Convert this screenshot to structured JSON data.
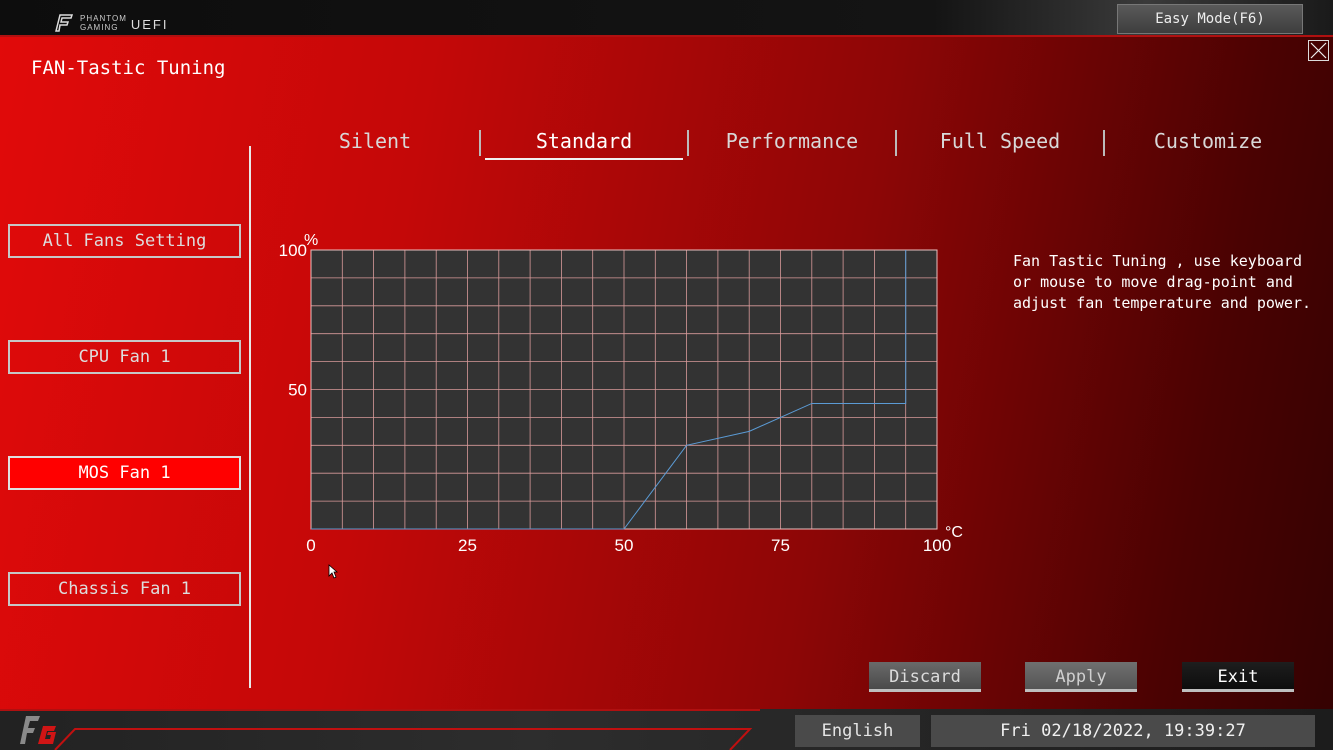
{
  "header": {
    "brand_line1": "PHANTOM",
    "brand_line2": "GAMING",
    "uefi_label": "UEFI",
    "easy_mode_label": "Easy Mode(F6)"
  },
  "page": {
    "title": "FAN-Tastic Tuning"
  },
  "sidebar": {
    "items": [
      {
        "label": "All Fans Setting",
        "active": false
      },
      {
        "label": "CPU Fan 1",
        "active": false
      },
      {
        "label": "MOS Fan 1",
        "active": true
      },
      {
        "label": "Chassis Fan 1",
        "active": false
      }
    ]
  },
  "tabs": [
    {
      "label": "Silent",
      "active": false
    },
    {
      "label": "Standard",
      "active": true
    },
    {
      "label": "Performance",
      "active": false
    },
    {
      "label": "Full Speed",
      "active": false
    },
    {
      "label": "Customize",
      "active": false
    }
  ],
  "chart_data": {
    "type": "line",
    "y_unit": "%",
    "x_unit": "°C",
    "xlim": [
      0,
      100
    ],
    "ylim": [
      0,
      100
    ],
    "x_ticks": [
      "0",
      "25",
      "50",
      "75",
      "100"
    ],
    "y_ticks": [
      "100",
      "50"
    ],
    "grid": true,
    "grid_step_x": 5,
    "grid_step_y": 10,
    "series": [
      {
        "x": [
          0,
          50,
          60,
          70,
          80,
          95,
          95
        ],
        "y": [
          0,
          0,
          30,
          35,
          45,
          45,
          100
        ]
      }
    ]
  },
  "help": {
    "text": "Fan Tastic Tuning , use keyboard\nor mouse to move drag-point and\nadjust fan temperature and power."
  },
  "actions": {
    "discard_label": "Discard",
    "apply_label": "Apply",
    "exit_label": "Exit"
  },
  "footer": {
    "language": "English",
    "datetime": "Fri 02/18/2022, 19:39:27"
  },
  "colors": {
    "accent": "#ff0000",
    "chart_background": "#333333",
    "grid_line": "#d89a9a",
    "curve_line": "#5b9bd5"
  }
}
